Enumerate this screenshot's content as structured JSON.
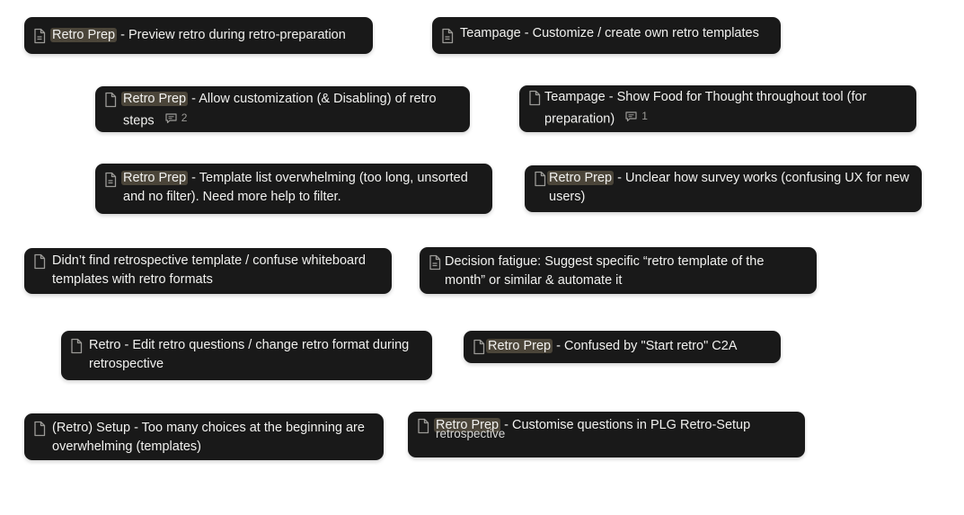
{
  "cards": [
    {
      "tag": "Retro Prep",
      "title": " - Preview retro during retro-preparation"
    },
    {
      "tag": "",
      "title": "Teampage - Customize / create own retro templates"
    },
    {
      "tag": "Retro Prep",
      "title": " - Allow customization (& Disabling) of retro steps",
      "comments": "2"
    },
    {
      "tag": "",
      "title": "Teampage - Show Food for Thought throughout tool (for preparation)",
      "comments": "1"
    },
    {
      "tag": "Retro Prep",
      "title": " - Template list overwhelming (too long, unsorted and no filter). Need more help to filter."
    },
    {
      "tag": "Retro Prep",
      "title": " - Unclear how survey works (confusing UX for new users)"
    },
    {
      "tag": "",
      "title": "Didn’t find retrospective template / confuse whiteboard templates with retro formats"
    },
    {
      "tag": "",
      "title": "Decision fatigue: Suggest specific “retro template of the month” or similar & automate it"
    },
    {
      "tag": "",
      "title": "Retro - Edit retro questions / change retro format during retrospective"
    },
    {
      "tag": "Retro Prep",
      "title": " - Confused by \"Start retro\" C2A"
    },
    {
      "tag": "",
      "title": "(Retro) Setup - Too many choices at the beginning are overwhelming (templates)"
    },
    {
      "tag": "Retro Prep",
      "title": " - Customise questions in PLG Retro-Setup",
      "overlap": "retrospective"
    }
  ],
  "icons": {
    "page": "page-icon",
    "comment": "comment-icon"
  }
}
